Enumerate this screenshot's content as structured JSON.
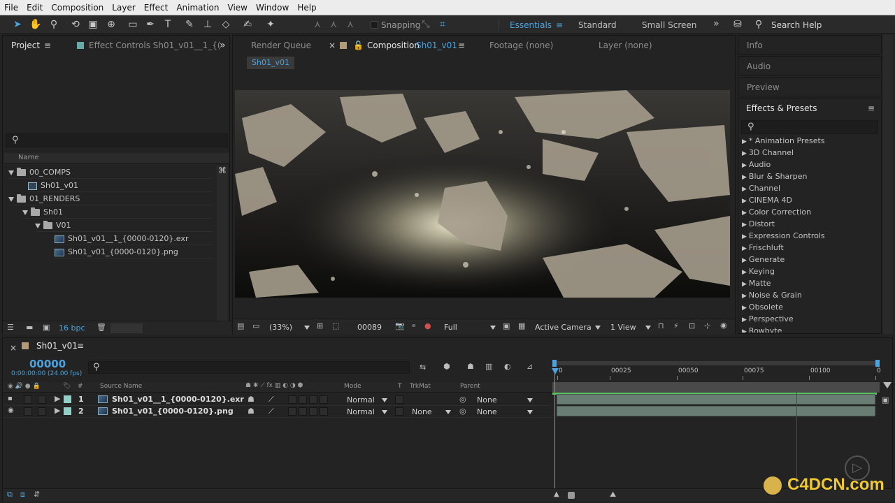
{
  "menu": [
    "File",
    "Edit",
    "Composition",
    "Layer",
    "Effect",
    "Animation",
    "View",
    "Window",
    "Help"
  ],
  "toolbar": {
    "snapping_label": "Snapping",
    "workspaces": [
      "Essentials",
      "Standard",
      "Small Screen"
    ],
    "active_workspace": "Essentials",
    "search_help": "Search Help"
  },
  "project_panel": {
    "tab_project": "Project",
    "tab_effect_controls": "Effect Controls Sh01_v01__1_{(",
    "column_name": "Name",
    "items": [
      {
        "label": "00_COMPS",
        "type": "folder",
        "depth": 0
      },
      {
        "label": "Sh01_v01",
        "type": "comp",
        "depth": 1
      },
      {
        "label": "01_RENDERS",
        "type": "folder",
        "depth": 0
      },
      {
        "label": "Sh01",
        "type": "folder",
        "depth": 1
      },
      {
        "label": "V01",
        "type": "folder",
        "depth": 2
      },
      {
        "label": "Sh01_v01__1_{0000-0120}.exr",
        "type": "footage",
        "depth": 3
      },
      {
        "label": "Sh01_v01_{0000-0120}.png",
        "type": "footage",
        "depth": 3
      }
    ],
    "bpc": "16 bpc"
  },
  "viewer": {
    "tab_render_queue": "Render Queue",
    "tab_composition": "Composition",
    "tab_composition_name": "Sh01_v01",
    "tab_footage": "Footage (none)",
    "tab_layer": "Layer (none)",
    "comp_chip": "Sh01_v01",
    "zoom": "(33%)",
    "frame": "00089",
    "resolution": "Full",
    "camera": "Active Camera",
    "views": "1 View"
  },
  "right_panels": {
    "info": "Info",
    "audio": "Audio",
    "preview": "Preview",
    "effects_title": "Effects & Presets",
    "effects": [
      "* Animation Presets",
      "3D Channel",
      "Audio",
      "Blur & Sharpen",
      "Channel",
      "CINEMA 4D",
      "Color Correction",
      "Distort",
      "Expression Controls",
      "Frischluft",
      "Generate",
      "Keying",
      "Matte",
      "Noise & Grain",
      "Obsolete",
      "Perspective",
      "Rowbyte"
    ]
  },
  "timeline": {
    "comp_tab": "Sh01_v01",
    "timecode": "00000",
    "timecode_sub": "0:00:00:00 (24.00 fps)",
    "columns": {
      "hash": "#",
      "source_name": "Source Name",
      "mode": "Mode",
      "t": "T",
      "trkmat": "TrkMat",
      "parent": "Parent"
    },
    "ruler": [
      "0",
      "00025",
      "00050",
      "00075",
      "00100",
      "0"
    ],
    "layers": [
      {
        "num": "1",
        "name": "Sh01_v01__1_{0000-0120}.exr",
        "mode": "Normal",
        "trkmat": "",
        "parent": "None"
      },
      {
        "num": "2",
        "name": "Sh01_v01_{0000-0120}.png",
        "mode": "Normal",
        "trkmat": "None",
        "parent": "None"
      }
    ]
  },
  "watermark": "C4DCN.com",
  "colors": {
    "accent": "#2d8ceb",
    "highlight": "#4aa3df",
    "layer_bar": "#6a7d75",
    "work_area": "#55c35a"
  }
}
